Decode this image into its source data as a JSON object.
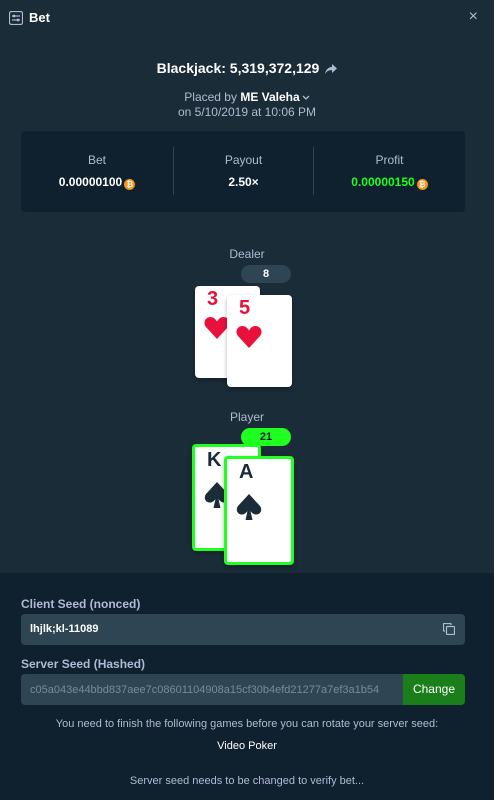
{
  "header": {
    "title": "Bet",
    "close": "×"
  },
  "game": {
    "title": "Blackjack: 5,319,372,129",
    "placed_prefix": "Placed by ",
    "user": "ME Valeha",
    "date": "on 5/10/2019 at 10:06 PM"
  },
  "stats": {
    "bet_label": "Bet",
    "bet_value": "0.00000100",
    "payout_label": "Payout",
    "payout_value": "2.50×",
    "profit_label": "Profit",
    "profit_value": "0.00000150",
    "coin_symbol": "₿"
  },
  "dealer": {
    "label": "Dealer",
    "score": "8",
    "cards": [
      {
        "rank": "3",
        "suit": "hearts"
      },
      {
        "rank": "5",
        "suit": "hearts"
      }
    ]
  },
  "player": {
    "label": "Player",
    "score": "21",
    "cards": [
      {
        "rank": "K",
        "suit": "spades"
      },
      {
        "rank": "A",
        "suit": "spades"
      }
    ]
  },
  "seeds": {
    "client_label": "Client Seed (nonced)",
    "client_value": "lhjlk;kl-11089",
    "server_label": "Server Seed (Hashed)",
    "server_value": "c05a043e44bbd837aee7c08601104908a15cf30b4efd21277a7ef3a1b54",
    "change_label": "Change",
    "rotate_note": "You need to finish the following games before you can rotate your server seed:",
    "pending_game": "Video Poker",
    "verify_note": "Server seed needs to be changed to verify bet..."
  },
  "colors": {
    "background": "#1a2c38",
    "panel": "#0f212e",
    "win": "#1fff20",
    "red_suit": "#e9113c"
  }
}
